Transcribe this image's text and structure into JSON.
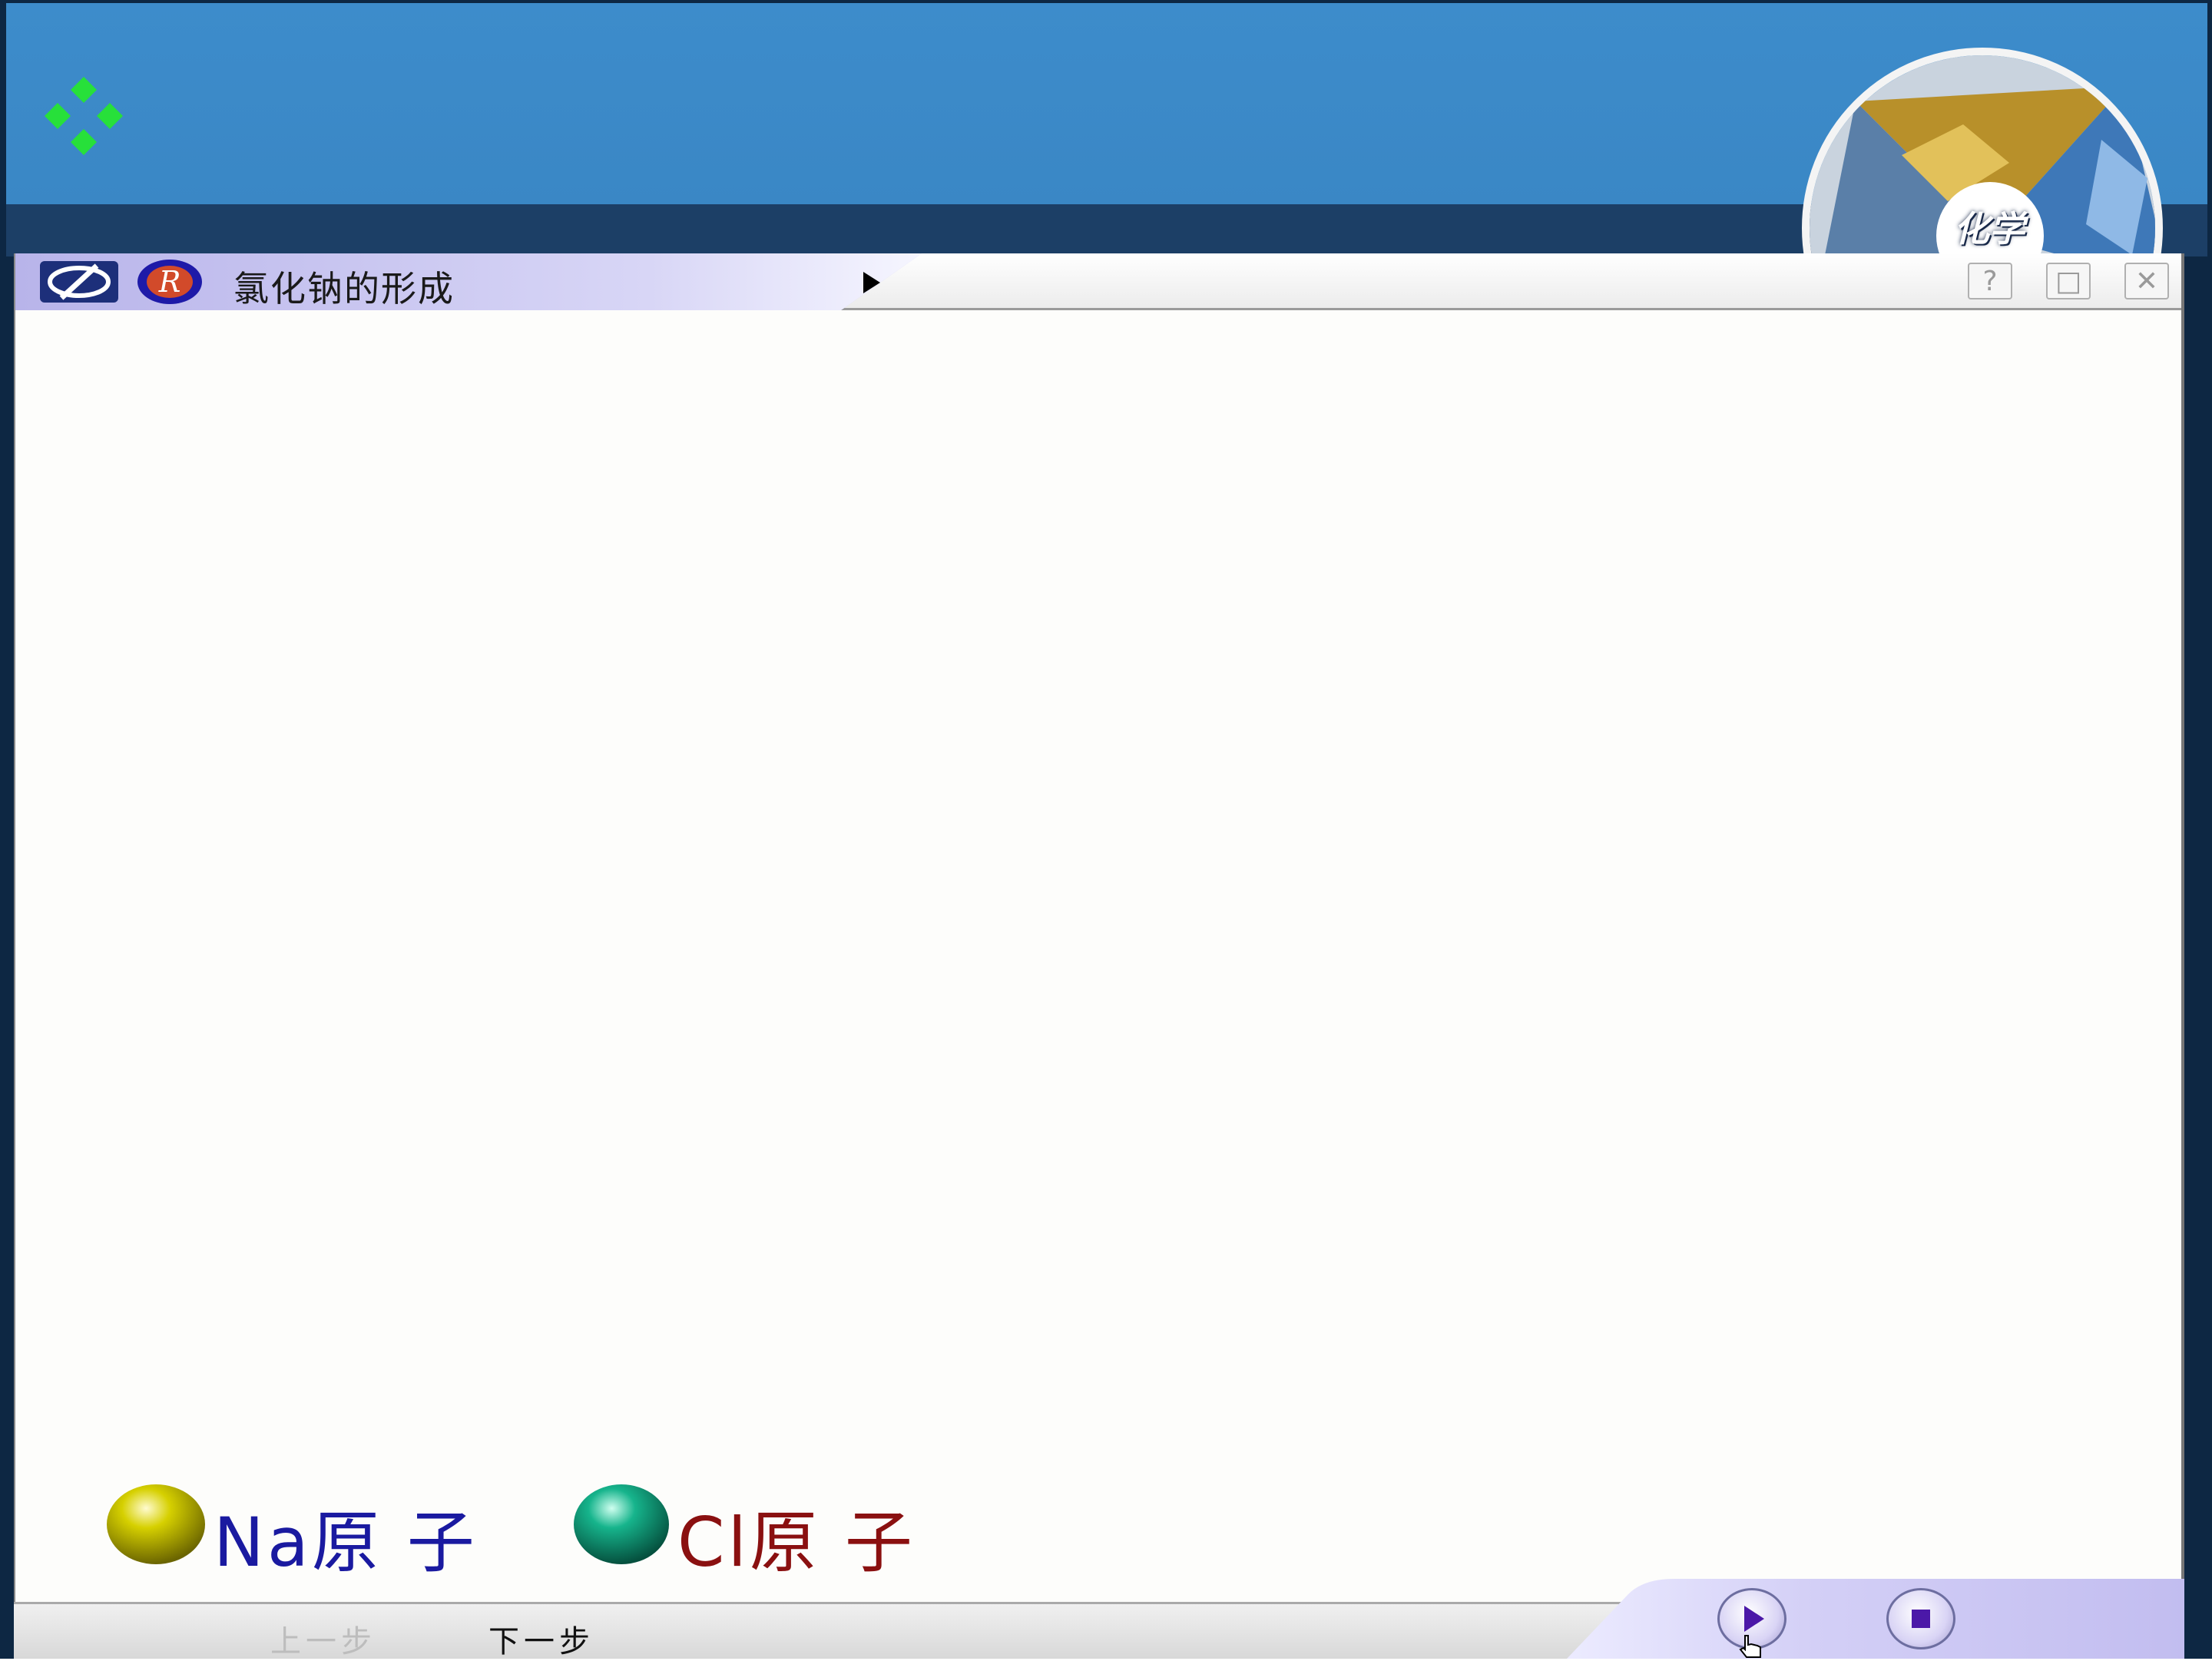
{
  "header": {
    "subject_label": "化学"
  },
  "window": {
    "title": "氯化钠的形成",
    "help_label": "?",
    "restore_label": "□",
    "close_label": "✕"
  },
  "legend": [
    {
      "label": "Na原 子",
      "color": "#1a1aa0",
      "sphere_color": "#b5b000"
    },
    {
      "label": "Cl原 子",
      "color": "#8a1010",
      "sphere_color": "#0f9a7a"
    }
  ],
  "navigation": {
    "prev_label": "上一步",
    "next_label": "下一步",
    "prev_enabled": false
  },
  "media": {
    "play_icon": "play-icon",
    "stop_icon": "stop-icon"
  },
  "colors": {
    "header_blue": "#3d8ccb",
    "title_tab": "#c9c6ef",
    "accent_purple": "#4b18a8"
  }
}
